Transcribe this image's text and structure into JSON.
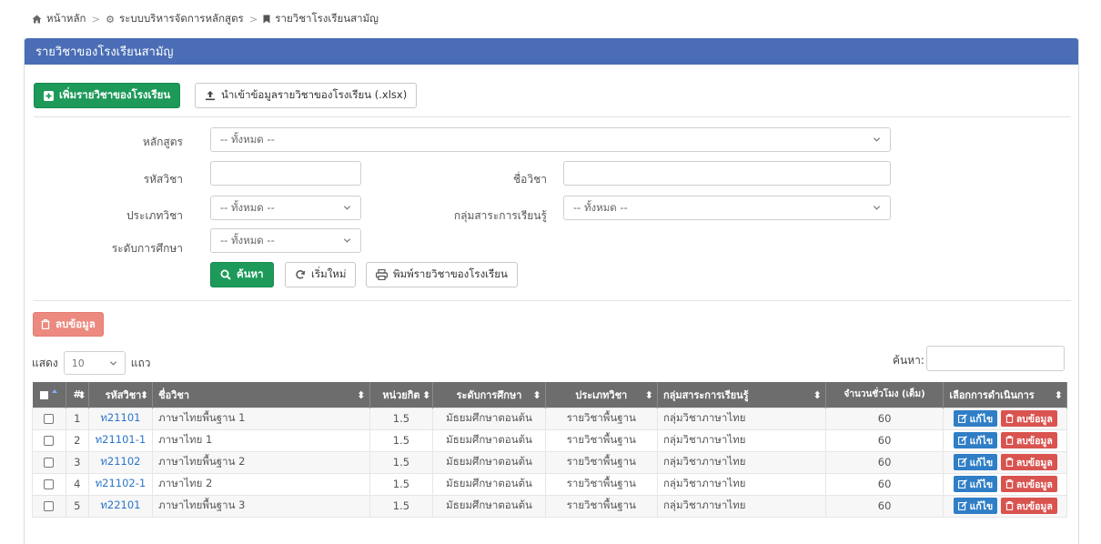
{
  "breadcrumb": {
    "home": "หน้าหลัก",
    "system": "ระบบบริหารจัดการหลักสูตร",
    "current": "รายวิชาโรงเรียนสามัญ"
  },
  "panel": {
    "title": "รายวิชาของโรงเรียนสามัญ",
    "add_button": "เพิ่มรายวิชาของโรงเรียน",
    "import_button": "นำเข้าข้อมูลรายวิชาของโรงเรียน (.xlsx)"
  },
  "filters": {
    "curriculum_label": "หลักสูตร",
    "curriculum_value": "-- ทั้งหมด --",
    "code_label": "รหัสวิชา",
    "code_value": "",
    "name_label": "ชื่อวิชา",
    "name_value": "",
    "type_label": "ประเภทวิชา",
    "type_value": "-- ทั้งหมด --",
    "group_label": "กลุ่มสาระการเรียนรู้",
    "group_value": "-- ทั้งหมด --",
    "level_label": "ระดับการศึกษา",
    "level_value": "-- ทั้งหมด --",
    "search_button": "ค้นหา",
    "reset_button": "เริ่มใหม่",
    "print_button": "พิมพ์รายวิชาของโรงเรียน"
  },
  "list": {
    "delete_button": "ลบข้อมูล",
    "show_label": "แสดง",
    "page_length": "10",
    "rows_label": "แถว",
    "search_label": "ค้นหา:",
    "search_value": ""
  },
  "table": {
    "headers": [
      "",
      "#",
      "รหัสวิชา",
      "ชื่อวิชา",
      "หน่วยกิต",
      "ระดับการศึกษา",
      "ประเภทวิชา",
      "กลุ่มสาระการเรียนรู้",
      "จำนวนชั่วโมง (เต็ม)",
      "เลือกการดำเนินการ"
    ],
    "edit_label": "แก้ไข",
    "delete_label": "ลบข้อมูล",
    "rows": [
      {
        "no": "1",
        "code": "ท21101",
        "name": "ภาษาไทยพื้นฐาน 1",
        "credit": "1.5",
        "level": "มัธยมศึกษาตอนต้น",
        "type": "รายวิชาพื้นฐาน",
        "group": "กลุ่มวิชาภาษาไทย",
        "hours": "60"
      },
      {
        "no": "2",
        "code": "ท21101-1",
        "name": "ภาษาไทย 1",
        "credit": "1.5",
        "level": "มัธยมศึกษาตอนต้น",
        "type": "รายวิชาพื้นฐาน",
        "group": "กลุ่มวิชาภาษาไทย",
        "hours": "60"
      },
      {
        "no": "3",
        "code": "ท21102",
        "name": "ภาษาไทยพื้นฐาน 2",
        "credit": "1.5",
        "level": "มัธยมศึกษาตอนต้น",
        "type": "รายวิชาพื้นฐาน",
        "group": "กลุ่มวิชาภาษาไทย",
        "hours": "60"
      },
      {
        "no": "4",
        "code": "ท21102-1",
        "name": "ภาษาไทย 2",
        "credit": "1.5",
        "level": "มัธยมศึกษาตอนต้น",
        "type": "รายวิชาพื้นฐาน",
        "group": "กลุ่มวิชาภาษาไทย",
        "hours": "60"
      },
      {
        "no": "5",
        "code": "ท22101",
        "name": "ภาษาไทยพื้นฐาน 3",
        "credit": "1.5",
        "level": "มัธยมศึกษาตอนต้น",
        "type": "รายวิชาพื้นฐาน",
        "group": "กลุ่มวิชาภาษาไทย",
        "hours": "60"
      }
    ]
  }
}
